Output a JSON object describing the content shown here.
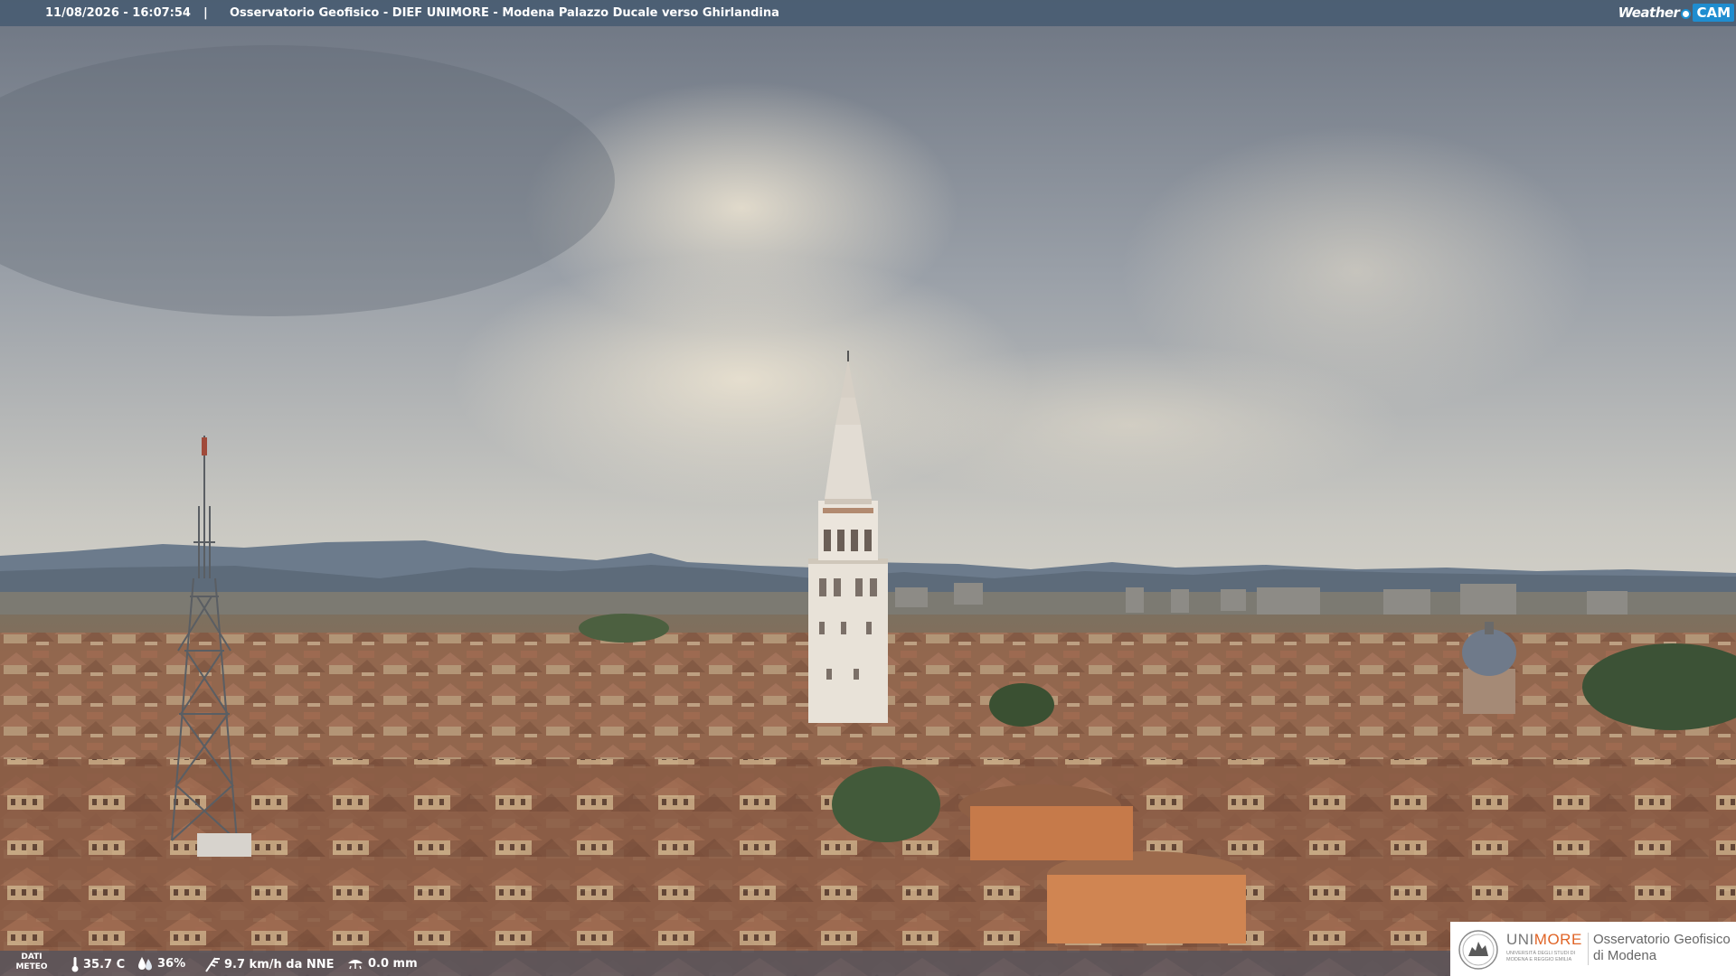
{
  "header": {
    "timestamp": "11/08/2026 - 16:07:54",
    "separator": "|",
    "title": "Osservatorio Geofisico - DIEF UNIMORE - Modena Palazzo Ducale verso Ghirlandina",
    "brand_weather": "Weather",
    "brand_cam": "CAM"
  },
  "weather": {
    "label": "DATI METEO",
    "temperature": "35.7 C",
    "humidity": "36%",
    "wind": "9.7 km/h da NNE",
    "rain": "0.0 mm",
    "icons": [
      "thermometer-icon",
      "humidity-drop-icon",
      "wind-icon",
      "rain-icon"
    ]
  },
  "logo": {
    "uni_prefix": "UNI",
    "uni_suffix": "MORE",
    "uni_sub": "UNIVERSITÀ DEGLI STUDI DI MODENA E REGGIO EMILIA",
    "observatory_line1": "Osservatorio Geofisico",
    "observatory_line2": "di Modena"
  },
  "colors": {
    "sky_top": "#6f7784",
    "sky_glow": "#e6dfcf",
    "mountains": "#68788a",
    "roofs": "#9a6a4f",
    "accent_orange": "#e06426",
    "brand_blue": "#1f8dd0"
  }
}
